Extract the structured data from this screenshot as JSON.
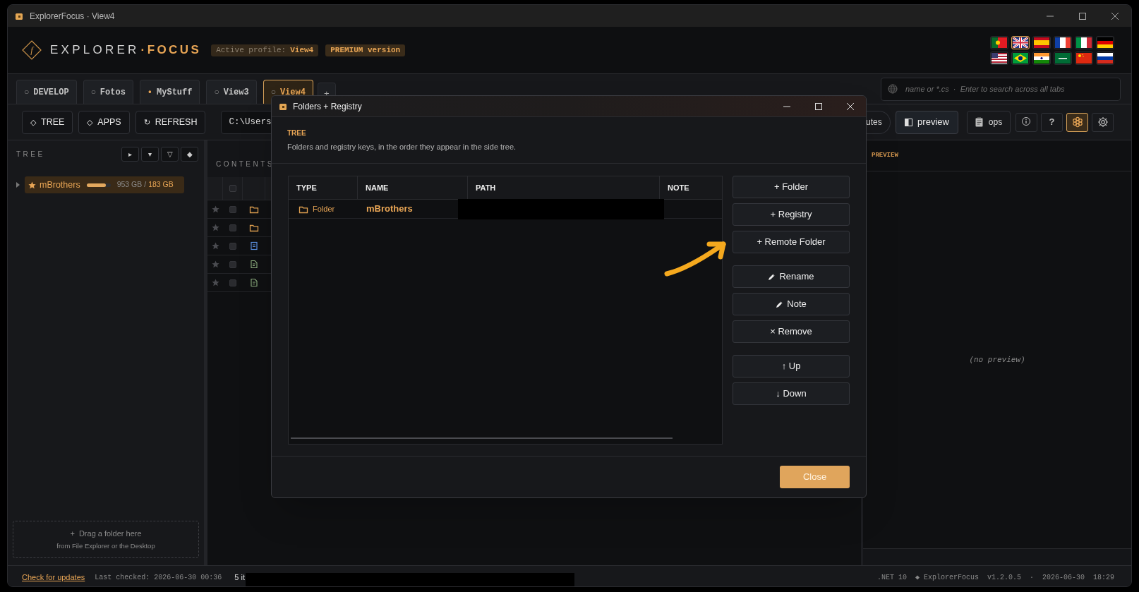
{
  "window": {
    "title": "ExplorerFocus · View4"
  },
  "header": {
    "logo_letter": "f",
    "brand_left": "EXPLORER",
    "brand_right": "·FOCUS",
    "profile_label": "Active profile:",
    "profile_value": "View4",
    "edition": "PREMIUM version",
    "flags": [
      {
        "kind": "portugal",
        "selected": false
      },
      {
        "kind": "uk",
        "selected": true
      },
      {
        "kind": "spain",
        "selected": false
      },
      {
        "kind": "france",
        "selected": false
      },
      {
        "kind": "italy",
        "selected": false
      },
      {
        "kind": "germany",
        "selected": false
      },
      {
        "kind": "usa",
        "selected": false
      },
      {
        "kind": "brazil",
        "selected": false
      },
      {
        "kind": "india",
        "selected": false
      },
      {
        "kind": "saudi",
        "selected": false
      },
      {
        "kind": "china",
        "selected": false
      },
      {
        "kind": "russia",
        "selected": false
      }
    ]
  },
  "tabs": [
    {
      "marker": "○",
      "label": "DEVELOP",
      "marked": false,
      "selected": false
    },
    {
      "marker": "○",
      "label": "Fotos",
      "marked": false,
      "selected": false
    },
    {
      "marker": "•",
      "label": "MyStuff",
      "marked": true,
      "selected": false
    },
    {
      "marker": "○",
      "label": "View3",
      "marked": false,
      "selected": false
    },
    {
      "marker": "○",
      "label": "View4",
      "marked": false,
      "selected": true
    }
  ],
  "add_tab": "+",
  "search": {
    "placeholder": "name or *.cs  ·  Enter to search across all tabs"
  },
  "toolbar": {
    "buttons": [
      {
        "icon": "◇",
        "label": "TREE"
      },
      {
        "icon": "◇",
        "label": "APPS"
      },
      {
        "icon": "↻",
        "label": "REFRESH"
      }
    ],
    "path": "C:\\Users",
    "attributes_button": "utes",
    "preview_button": "preview",
    "ops_button": "ops",
    "icon_buttons": [
      {
        "kind": "info",
        "selected": false
      },
      {
        "kind": "help",
        "text": "?",
        "selected": false
      },
      {
        "kind": "flower",
        "selected": true
      },
      {
        "kind": "gear",
        "selected": false
      }
    ]
  },
  "tree_panel": {
    "title": "TREE",
    "buttons": [
      "▸",
      "▾",
      "▽",
      "◆"
    ],
    "items": [
      {
        "name": "mBrothers",
        "expanded": false,
        "starred": true,
        "selected": true,
        "level": 0.8,
        "used": "953 GB",
        "separator": "/",
        "total": "183 GB"
      }
    ],
    "drop_zone": {
      "line1": "+  Drag a folder here",
      "line2": "from File Explorer or the Desktop"
    }
  },
  "contents": {
    "title": "CONTENTS",
    "select_all_checked": false,
    "rows": [
      {
        "kind": "folder",
        "starred": false,
        "checked": false
      },
      {
        "kind": "folder",
        "starred": false,
        "checked": false
      },
      {
        "kind": "image",
        "starred": false,
        "checked": false
      },
      {
        "kind": "document",
        "starred": false,
        "checked": false
      },
      {
        "kind": "document",
        "starred": false,
        "checked": false
      }
    ]
  },
  "preview": {
    "title": "PREVIEW",
    "empty_text": "(no preview)"
  },
  "status_bar": {
    "link": "Check for updates",
    "last_checked": "Last checked: 2026-06-30 00:36",
    "items_count": "5 it",
    "redacted": true,
    "runtime": ".NET 10",
    "app": "◆ ExplorerFocus",
    "version": "v1.2.0.5",
    "separator": "·",
    "date": "2026-06-30",
    "time": "18:29"
  },
  "dialog": {
    "title": "Folders + Registry",
    "section_title": "TREE",
    "description": "Folders and registry keys, in the order they appear in the side tree.",
    "columns": [
      "TYPE",
      "NAME",
      "PATH",
      "NOTE"
    ],
    "rows": [
      {
        "type": "Folder",
        "name": "mBrothers",
        "path_redacted": true
      }
    ],
    "button_groups": [
      [
        {
          "kind": "plain",
          "label": "+ Folder"
        },
        {
          "kind": "plain",
          "label": "+ Registry"
        },
        {
          "kind": "plain",
          "label": "+ Remote Folder"
        }
      ],
      [
        {
          "kind": "pencil",
          "label": "Rename"
        },
        {
          "kind": "pencil",
          "label": "Note"
        },
        {
          "kind": "plain",
          "label": "× Remove"
        }
      ],
      [
        {
          "kind": "plain",
          "label": "↑ Up"
        },
        {
          "kind": "plain",
          "label": "↓ Down"
        }
      ]
    ],
    "close_button": "Close"
  }
}
